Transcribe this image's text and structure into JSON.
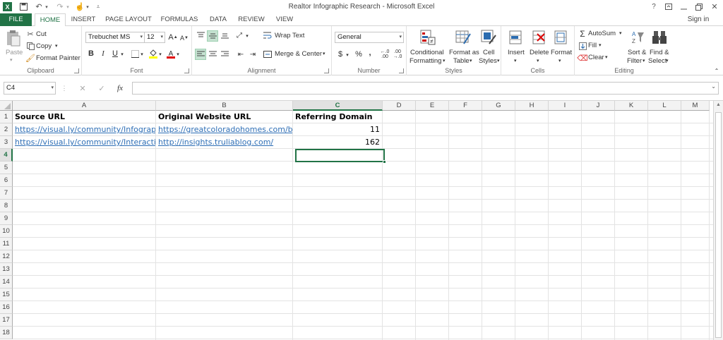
{
  "window": {
    "title": "Realtor Infographic Research - Microsoft Excel",
    "help": "?",
    "sign_in": "Sign in"
  },
  "ribbon_tabs": [
    "FILE",
    "HOME",
    "INSERT",
    "PAGE LAYOUT",
    "FORMULAS",
    "DATA",
    "REVIEW",
    "VIEW"
  ],
  "clipboard": {
    "paste": "Paste",
    "cut": "Cut",
    "copy": "Copy",
    "format_painter": "Format Painter",
    "group": "Clipboard"
  },
  "font": {
    "name": "Trebuchet MS",
    "size": "12",
    "bold": "B",
    "italic": "I",
    "underline": "U",
    "group": "Font"
  },
  "alignment": {
    "wrap_text": "Wrap Text",
    "merge_center": "Merge & Center",
    "group": "Alignment"
  },
  "number": {
    "format": "General",
    "currency": "$",
    "percent": "%",
    "comma": ",",
    "group": "Number"
  },
  "styles": {
    "conditional_l1": "Conditional",
    "conditional_l2": "Formatting",
    "format_table_l1": "Format as",
    "format_table_l2": "Table",
    "cell_styles_l1": "Cell",
    "cell_styles_l2": "Styles",
    "group": "Styles"
  },
  "cells": {
    "insert": "Insert",
    "delete": "Delete",
    "format": "Format",
    "group": "Cells"
  },
  "editing": {
    "autosum": "AutoSum",
    "fill": "Fill",
    "clear": "Clear",
    "sort_l1": "Sort &",
    "sort_l2": "Filter",
    "find_l1": "Find &",
    "find_l2": "Select",
    "group": "Editing"
  },
  "formula_bar": {
    "name_box": "C4",
    "fx": "fx",
    "formula": ""
  },
  "columns": [
    "A",
    "B",
    "C",
    "D",
    "E",
    "F",
    "G",
    "H",
    "I",
    "J",
    "K",
    "L",
    "M"
  ],
  "selected_column": "C",
  "selected_row": "4",
  "rows": [
    "1",
    "2",
    "3",
    "4",
    "5",
    "6",
    "7",
    "8",
    "9",
    "10",
    "11",
    "12",
    "13",
    "14",
    "15",
    "16",
    "17",
    "18"
  ],
  "sheet": {
    "A1": "Source URL",
    "B1": "Original Website URL",
    "C1": "Referring Domain",
    "A2": "https://visual.ly/community/Infographic",
    "B2": "https://greatcoloradohomes.com/b",
    "C2": "11",
    "A3": "https://visual.ly/community/Interactive",
    "B3": "http://insights.truliablog.com/",
    "C3": "162"
  },
  "colors": {
    "accent": "#217346",
    "link": "#2f6fb6"
  }
}
